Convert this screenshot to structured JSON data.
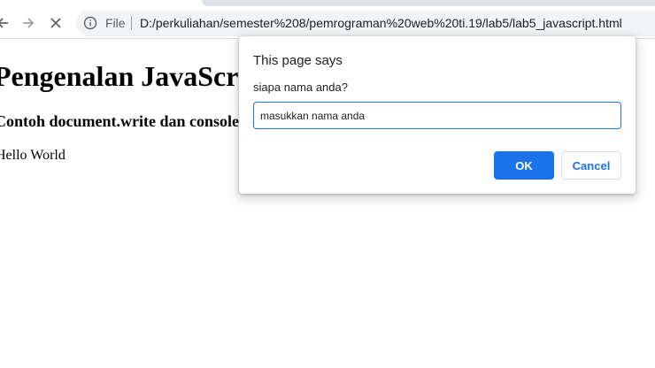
{
  "browser": {
    "site_label": "File",
    "url": "D:/perkuliahan/semester%208/pemrograman%20web%20ti.19/lab5/lab5_javascript.html",
    "icons": {
      "back": "arrow-left-icon",
      "forward": "arrow-right-icon",
      "stop": "close-icon",
      "info": "info-circle-icon"
    }
  },
  "page": {
    "heading": "Pengenalan JavaScript",
    "subheading": "Contoh document.write dan console",
    "paragraph": "Hello World"
  },
  "dialog": {
    "title": "This page says",
    "message": "siapa nama anda?",
    "input_value": "masukkan nama anda",
    "ok_label": "OK",
    "cancel_label": "Cancel"
  },
  "colors": {
    "accent": "#1a73e8",
    "omnibox_bg": "#f1f3f4"
  }
}
